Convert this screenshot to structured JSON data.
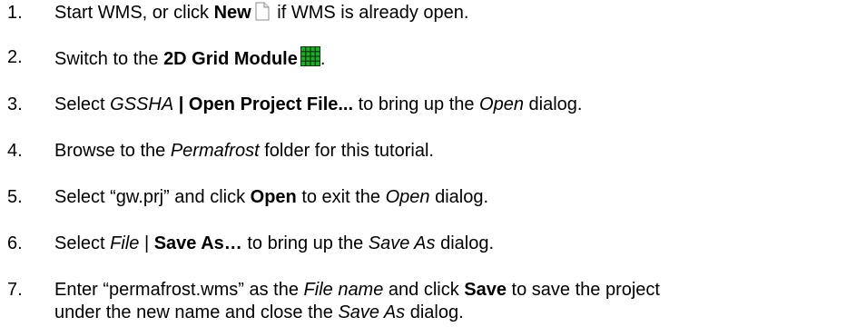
{
  "steps": [
    {
      "number": "1.",
      "parts": [
        "Start WMS, or click ",
        "New",
        " if WMS is already open."
      ],
      "icon": "new-file-icon"
    },
    {
      "number": "2.",
      "parts": [
        "Switch to the ",
        "2D Grid Module",
        "."
      ],
      "icon": "2d-grid-module-icon"
    },
    {
      "number": "3.",
      "parts": [
        "Select ",
        "GSSHA",
        " | Open Project File...",
        " to bring up the ",
        "Open",
        " dialog."
      ]
    },
    {
      "number": "4.",
      "parts": [
        "Browse to the ",
        "Permafrost",
        " folder for this tutorial."
      ]
    },
    {
      "number": "5.",
      "parts": [
        "Select “gw.prj” and click ",
        "Open",
        " to exit the ",
        "Open",
        " dialog."
      ]
    },
    {
      "number": "6.",
      "parts": [
        "Select ",
        "File",
        " | ",
        "Save As…",
        " to bring up the ",
        "Save As",
        " dialog."
      ]
    },
    {
      "number": "7.",
      "parts": [
        "Enter “permafrost.wms” as the ",
        "File name",
        " and click ",
        "Save",
        " to save the project"
      ],
      "parts_line2": [
        "under the new name and close the ",
        "Save As",
        " dialog."
      ]
    }
  ],
  "colors": {
    "text": "#000000",
    "grid_icon_fill": "#22a82a",
    "grid_icon_line": "#0b3d10"
  }
}
